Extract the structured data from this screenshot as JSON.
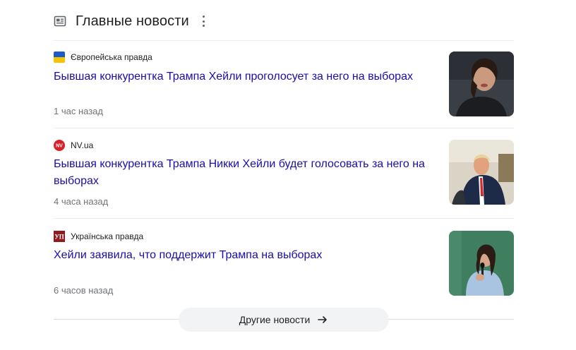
{
  "header": {
    "title": "Главные новости",
    "icon": "newspaper-icon",
    "menu_icon": "more-vert-icon"
  },
  "stories": [
    {
      "source": "Європейська правда",
      "favicon": "ukraine-flag-icon",
      "headline": "Бывшая конкурентка Трампа Хейли проголосует за него на выборах",
      "time": "1 час назад",
      "thumbnail": "woman-portrait-dark-background"
    },
    {
      "source": "NV.ua",
      "favicon_text": "NV",
      "favicon": "nv-logo-icon",
      "headline": "Бывшая конкурентка Трампа Никки Хейли будет голосовать за него на выборах",
      "time": "4 часа назад",
      "thumbnail": "man-seated-suit-red-tie"
    },
    {
      "source": "Українська правда",
      "favicon_text": "УП",
      "favicon": "up-logo-icon",
      "headline": "Хейли заявила, что поддержит Трампа на выборах",
      "time": "6 часов назад",
      "thumbnail": "woman-speaking-microphone-green-background"
    }
  ],
  "more_news": {
    "label": "Другие новости",
    "icon": "arrow-right-icon"
  },
  "colors": {
    "headline": "#1a0dab",
    "meta": "#70757a",
    "button_bg": "#f1f3f4",
    "divider": "#ebebeb"
  }
}
